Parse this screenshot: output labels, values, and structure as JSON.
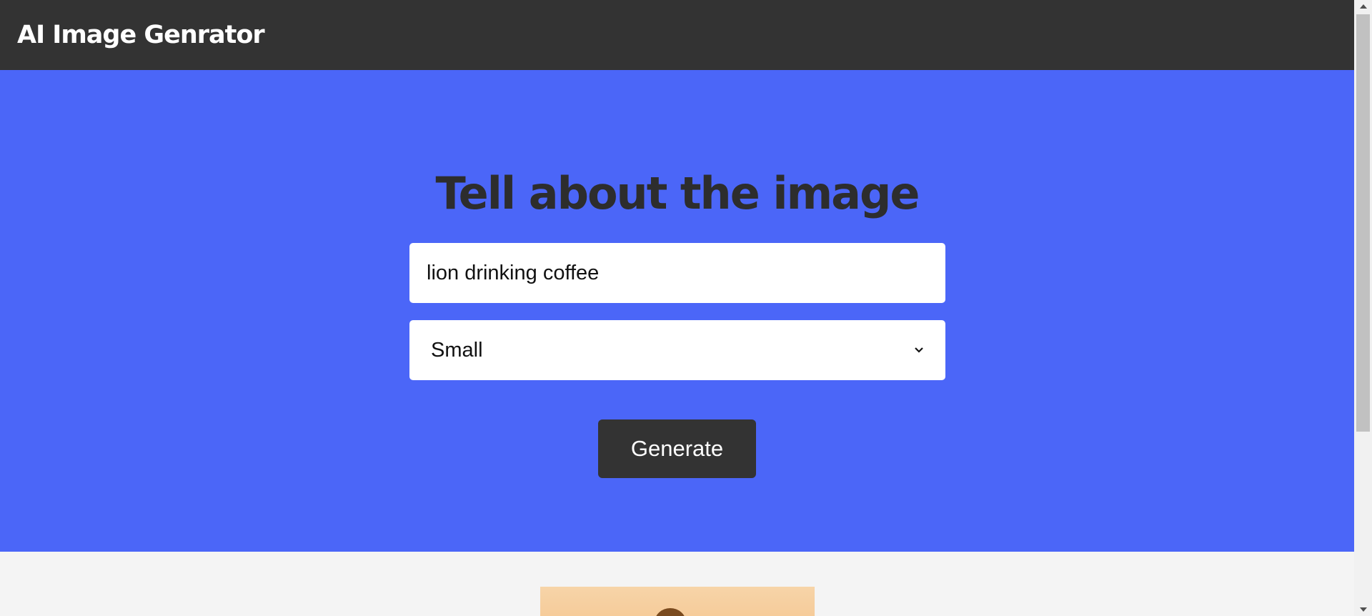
{
  "navbar": {
    "brand": "AI Image Genrator"
  },
  "hero": {
    "heading": "Tell about the image",
    "prompt_value": "lion drinking coffee",
    "size_select": {
      "selected": "Small"
    },
    "generate_label": "Generate"
  },
  "colors": {
    "navbar_bg": "#333333",
    "hero_bg": "#4b66f8",
    "heading_text": "#2d2d2d",
    "button_bg": "#333333",
    "page_bg": "#f4f4f4"
  },
  "icons": {
    "select_arrow": "chevron-down-icon",
    "scroll_up": "scroll-up-arrow-icon",
    "scroll_down": "scroll-down-arrow-icon"
  }
}
